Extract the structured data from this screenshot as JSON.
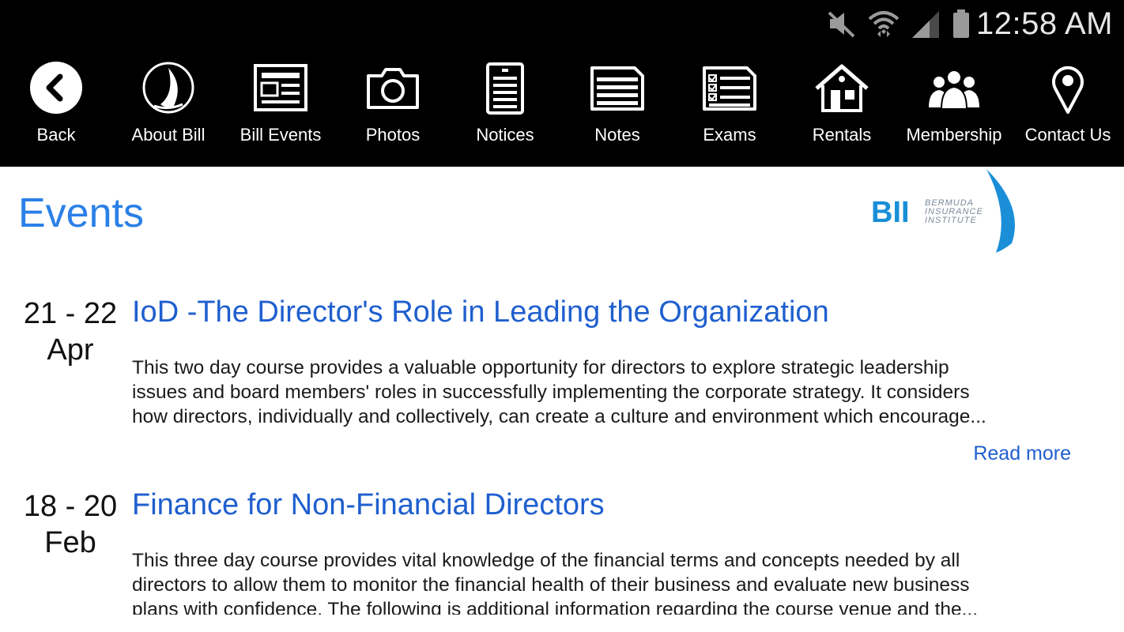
{
  "status_bar": {
    "time": "12:58 AM",
    "icons": [
      "mute-icon",
      "wifi-icon",
      "signal-icon",
      "battery-icon"
    ]
  },
  "nav": {
    "items": [
      {
        "label": "Back",
        "icon": "back-arrow-icon"
      },
      {
        "label": "About Bill",
        "icon": "sailboat-icon"
      },
      {
        "label": "Bill Events",
        "icon": "newspaper-icon"
      },
      {
        "label": "Photos",
        "icon": "camera-icon"
      },
      {
        "label": "Notices",
        "icon": "notice-icon"
      },
      {
        "label": "Notes",
        "icon": "notes-icon"
      },
      {
        "label": "Exams",
        "icon": "exams-checklist-icon"
      },
      {
        "label": "Rentals",
        "icon": "house-icon"
      },
      {
        "label": "Membership",
        "icon": "people-icon"
      },
      {
        "label": "Contact Us",
        "icon": "location-pin-icon"
      }
    ]
  },
  "page": {
    "title": "Events",
    "logo": {
      "letters": "BII",
      "line1": "BERMUDA",
      "line2": "INSURANCE",
      "line3": "INSTITUTE",
      "accent_color": "#1a8fd8"
    }
  },
  "events": [
    {
      "date_range": "21 - 22",
      "month": "Apr",
      "title": "IoD -The Director's Role in Leading the Organization",
      "description_lines": [
        "This two day course provides a valuable opportunity for directors to explore strategic leadership",
        "issues and board members' roles in successfully implementing the corporate strategy. It considers",
        "how directors, individually and collectively, can create a culture and environment which encourage..."
      ],
      "read_more": "Read more"
    },
    {
      "date_range": "18 - 20",
      "month": "Feb",
      "title": "Finance for Non-Financial Directors",
      "description_lines": [
        "This three day course provides vital knowledge of the financial terms and concepts needed by all",
        "directors to allow them to monitor the financial health of their business and evaluate new business",
        "plans with confidence. The following is additional information regarding the course venue and the..."
      ]
    }
  ],
  "colors": {
    "title_blue": "#2b80e8",
    "link_blue": "#1f5fcf",
    "nav_background": "#000000"
  }
}
